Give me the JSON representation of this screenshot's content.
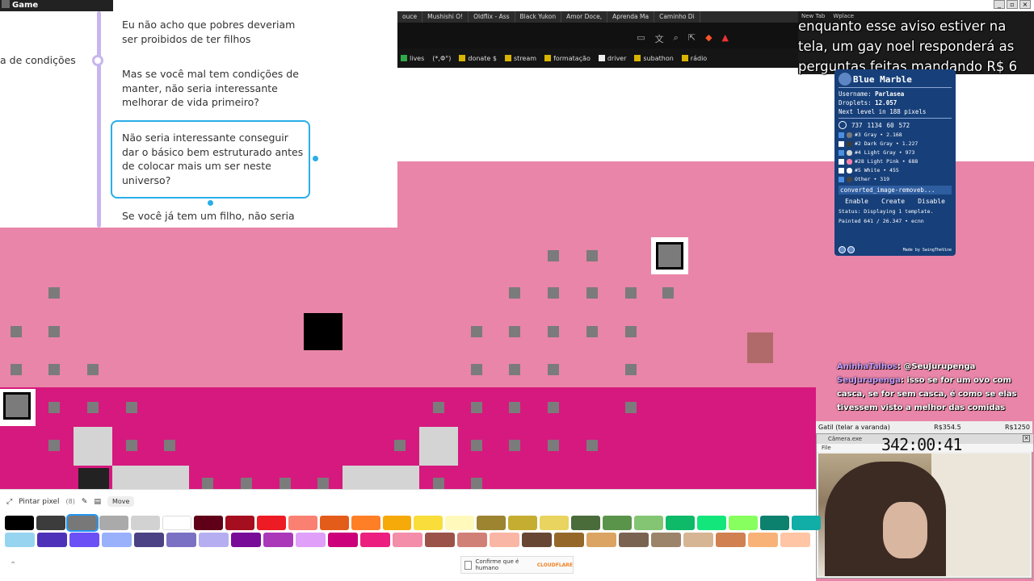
{
  "window": {
    "title": "Game"
  },
  "mindmap": {
    "left_label": "a de condições",
    "nodes": [
      "Eu não acho que pobres deveriam ser proibidos de ter filhos",
      "Mas se você mal tem condições de manter, não seria interessante melhorar de vida primeiro?",
      "Não seria interessante conseguir dar o básico bem estruturado antes de colocar mais um ser neste universo?",
      "Se você já tem um filho, não seria"
    ]
  },
  "browser": {
    "tabs": [
      "ouce",
      "Mushishi O!",
      "Oldflix - Ass",
      "Black Yukon",
      "Amor Doce,",
      "Aprenda Ma",
      "Caminho Di",
      "New Tab",
      "Wplace"
    ],
    "bookmarks": [
      "lives",
      "(*,Φ°)",
      "donate $",
      "stream",
      "formatação",
      "driver",
      "subathon",
      "rádio"
    ]
  },
  "overlay_message": "enquanto esse aviso estiver na tela, um gay noel responderá as perguntas feitas mandando R$ 6",
  "blue_marble": {
    "title": "Blue Marble",
    "username_label": "Username:",
    "username": "Parlasea",
    "droplets_label": "Droplets:",
    "droplets": "12.057",
    "next_level": "Next level in 188 pixels",
    "coords": [
      "737",
      "1134",
      "60",
      "572"
    ],
    "colors": [
      {
        "label": "#3 Gray • 2.168",
        "swatch": "#787878",
        "checked": true
      },
      {
        "label": "#2 Dark Gray • 1.227",
        "swatch": "#3c3c3c",
        "checked": false
      },
      {
        "label": "#4 Light Gray • 973",
        "swatch": "#d2d2d2",
        "checked": true
      },
      {
        "label": "#28 Light Pink • 688",
        "swatch": "#fa80aa",
        "checked": false
      },
      {
        "label": "#5 White • 455",
        "swatch": "#ffffff",
        "checked": false
      },
      {
        "label": "Other • 319",
        "swatch": "#444444",
        "checked": true
      }
    ],
    "file": "converted_image-removeb...",
    "buttons": [
      "Enable",
      "Create",
      "Disable"
    ],
    "status": "Status: Displaying 1 template.",
    "painted": "Painted 641 / 26.347 • ecnn",
    "credit": "Made by SwingTheVine"
  },
  "chat": [
    {
      "user": "AninhaTalhos",
      "text": ": @SeuJurupenga"
    },
    {
      "user": "SeuJurupenga",
      "text": ": isso se for um ovo com casca, se for sem casca, é como se elas tivessem visto a melhor das comidas"
    }
  ],
  "stream": {
    "goal_left": "Gatil (telar a varanda)",
    "goal_mid": "R$354.5",
    "goal_right": "R$1250",
    "cam_title": "Câmera.exe",
    "cam_menu": "File",
    "timer": "342:00:41"
  },
  "palette": {
    "mode_label": "Pintar pixel",
    "count": "(8)",
    "move_label": "Move",
    "captcha_label": "Confirme que é humano",
    "captcha_brand": "CLOUDFLARE",
    "row1": [
      "#000000",
      "#3c3c3c",
      "#787878",
      "#aaaaaa",
      "#d2d2d2",
      "#ffffff",
      "#600018",
      "#a50e1e",
      "#ed1c24",
      "#fa8072",
      "#e45c1a",
      "#ff7f27",
      "#f6aa09",
      "#f9dd3b",
      "#fffabc",
      "#9c8431",
      "#c5ad31",
      "#e8d45f",
      "#4a6b3a",
      "#5a944a",
      "#84c573",
      "#0eb968",
      "#13e67b",
      "#87ff5e",
      "#0c816e",
      "#10aea6"
    ],
    "row2": [
      "#96d4f0",
      "#4d31b8",
      "#6b50f6",
      "#99b1fb",
      "#4a4284",
      "#7a71c4",
      "#b5aef1",
      "#780c99",
      "#aa38b9",
      "#e09ff9",
      "#cb007a",
      "#ec1f80",
      "#f38da9",
      "#9b5249",
      "#d18078",
      "#fab6a4",
      "#684634",
      "#95682a",
      "#dba463",
      "#7b6352",
      "#9c846b",
      "#d6b594",
      "#d18051",
      "#f8b277",
      "#ffc5a5"
    ]
  }
}
